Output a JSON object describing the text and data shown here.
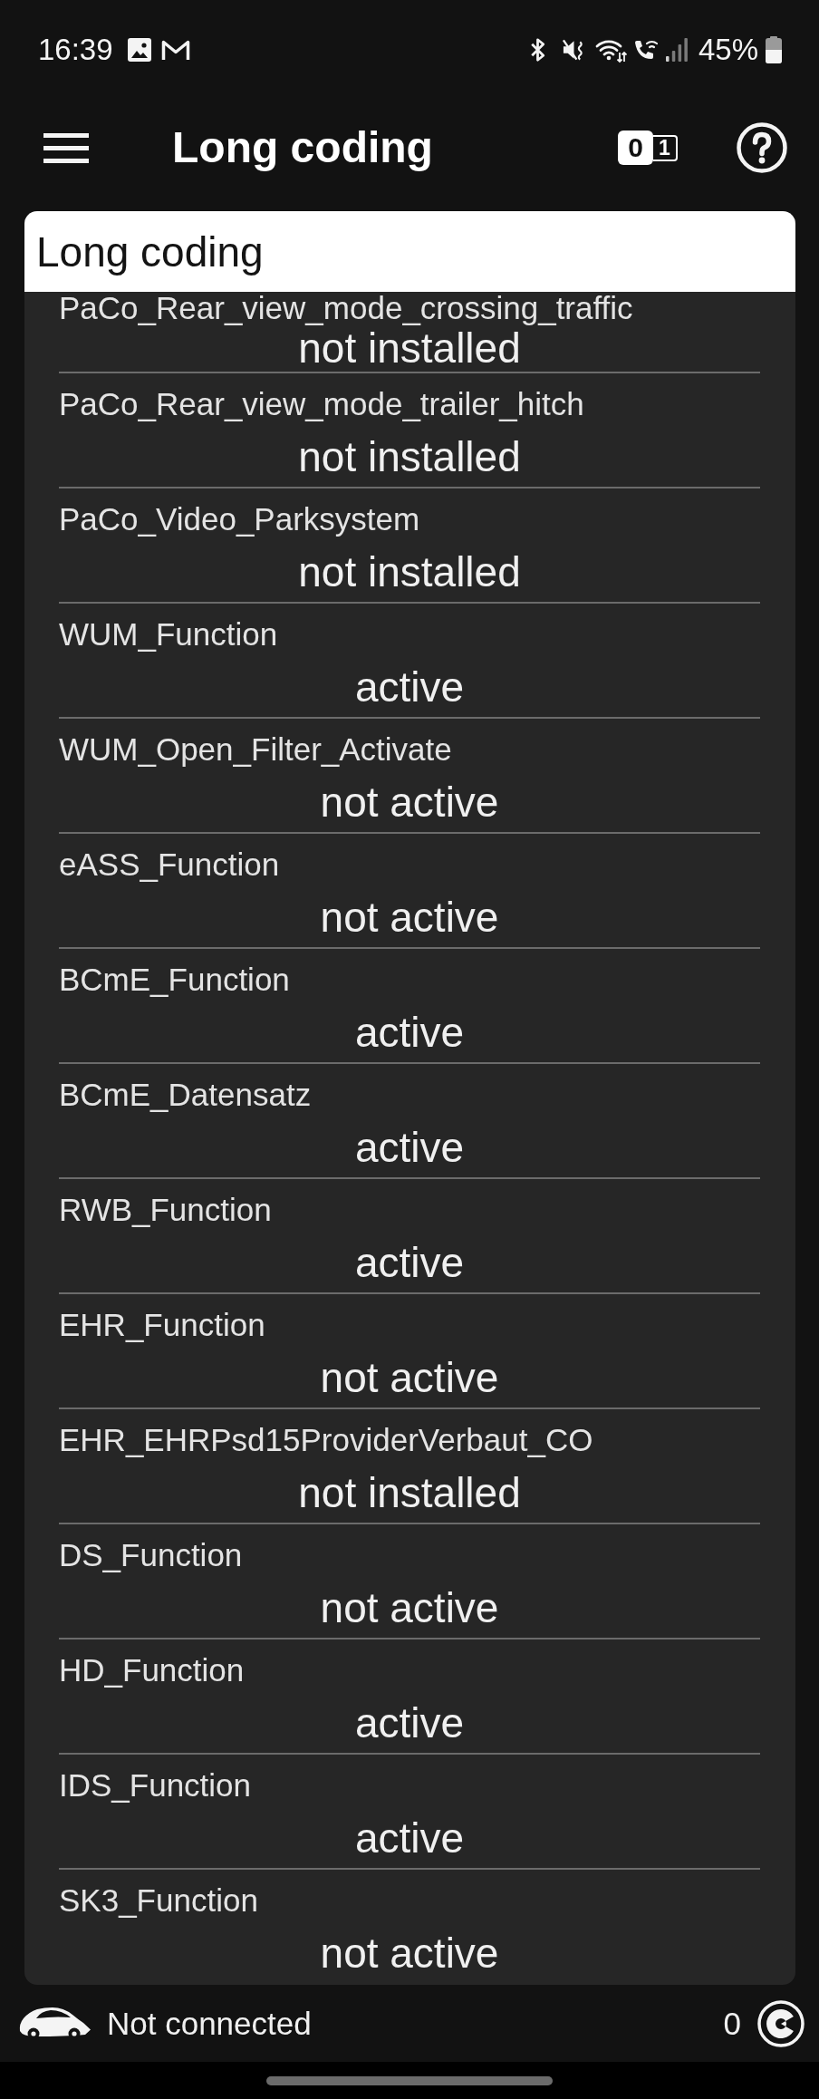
{
  "status_bar": {
    "time": "16:39",
    "battery": "45%"
  },
  "toolbar": {
    "title": "Long coding",
    "format_toggle": [
      "0",
      "1"
    ]
  },
  "card": {
    "title": "Long coding",
    "items": [
      {
        "name": "PaCo_Rear_view_mode_crossing_traffic",
        "value": "not installed"
      },
      {
        "name": "PaCo_Rear_view_mode_trailer_hitch",
        "value": "not installed"
      },
      {
        "name": "PaCo_Video_Parksystem",
        "value": "not installed"
      },
      {
        "name": "WUM_Function",
        "value": "active"
      },
      {
        "name": "WUM_Open_Filter_Activate",
        "value": "not active"
      },
      {
        "name": "eASS_Function",
        "value": "not active"
      },
      {
        "name": "BCmE_Function",
        "value": "active"
      },
      {
        "name": "BCmE_Datensatz",
        "value": "active"
      },
      {
        "name": "RWB_Function",
        "value": "active"
      },
      {
        "name": "EHR_Function",
        "value": "not active"
      },
      {
        "name": "EHR_EHRPsd15ProviderVerbaut_CO",
        "value": "not installed"
      },
      {
        "name": "DS_Function",
        "value": "not active"
      },
      {
        "name": "HD_Function",
        "value": "active"
      },
      {
        "name": "IDS_Function",
        "value": "active"
      },
      {
        "name": "SK3_Function",
        "value": "not active"
      }
    ]
  },
  "connection_bar": {
    "status": "Not connected",
    "count": "0"
  }
}
